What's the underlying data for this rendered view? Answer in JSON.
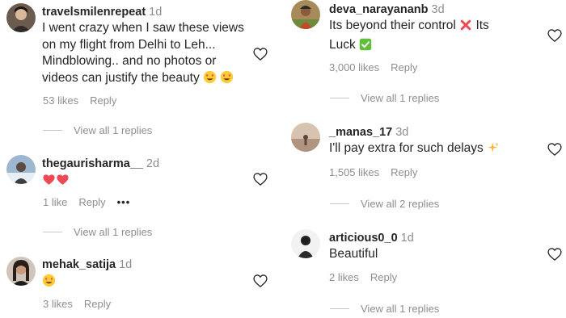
{
  "left": [
    {
      "user": "travelsmilenrepeat",
      "time": "1d",
      "lines": [
        "I went crazy when I saw these views",
        "on my flight from Delhi to Leh...",
        "Mindblowing.. and no photos or",
        "videos can justify the beauty"
      ],
      "likes": "53 likes",
      "reply": "Reply",
      "view_replies": "View all 1 replies"
    },
    {
      "user": "thegaurisharma__",
      "time": "2d",
      "likes": "1 like",
      "reply": "Reply",
      "more": "•••",
      "view_replies": "View all 1 replies"
    },
    {
      "user": "mehak_satija",
      "time": "1d",
      "likes": "3 likes",
      "reply": "Reply"
    }
  ],
  "right": [
    {
      "user": "deva_narayananb",
      "time": "3d",
      "line1": "Its beyond their control",
      "line1b": "Its",
      "line2": "Luck",
      "likes": "3,000 likes",
      "reply": "Reply",
      "view_replies": "View all 1 replies"
    },
    {
      "user": "_manas_17",
      "time": "3d",
      "line1": "I'll pay extra for such delays",
      "likes": "1,505 likes",
      "reply": "Reply",
      "view_replies": "View all 2 replies"
    },
    {
      "user": "articious0_0",
      "time": "1d",
      "line1": "Beautiful",
      "likes": "2 likes",
      "reply": "Reply",
      "view_replies": "View all 1 replies"
    }
  ],
  "icons": {
    "like": "heart-outline-icon",
    "heart_eyes": "heart-eyes-emoji-icon",
    "red_heart": "red-heart-emoji-icon",
    "cross": "cross-mark-emoji-icon",
    "check": "check-mark-emoji-icon",
    "sparkles": "sparkles-emoji-icon"
  },
  "colors": {
    "text": "#262626",
    "secondary": "#8e8e8e",
    "divider": "#c7c7c7",
    "heart_red": "#ed4956",
    "check_green": "#5fbf3b",
    "sparkle_gold": "#f6b93b"
  }
}
